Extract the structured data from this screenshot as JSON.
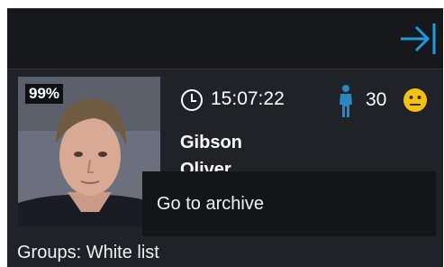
{
  "event_card": {
    "confidence": "99%",
    "time": "15:07:22",
    "age": "30",
    "surname": "Gibson",
    "first_name": "Oliver",
    "groups": "Groups: White list"
  },
  "tooltip": {
    "text": "Go to archive"
  },
  "icons": {
    "collapse": "collapse-right-icon",
    "clock": "clock-icon",
    "person": "person-icon",
    "mood": "neutral-smiley-icon"
  },
  "colors": {
    "accent": "#1e9be0",
    "person_icon": "#2e86c1",
    "smiley": "#f5c211",
    "background": "#202327"
  }
}
